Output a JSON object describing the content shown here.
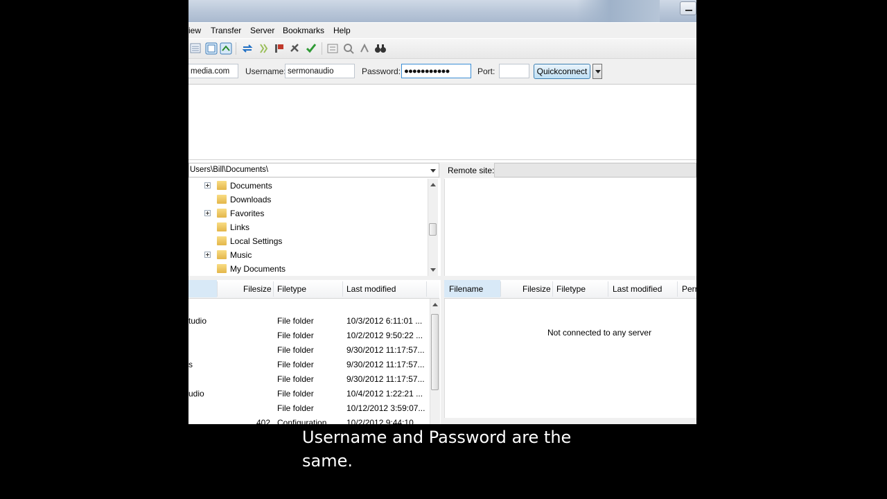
{
  "window": {
    "title": ""
  },
  "menu": [
    "iew",
    "Transfer",
    "Server",
    "Bookmarks",
    "Help"
  ],
  "quickconnect": {
    "host_value": "media.com",
    "username_label": "Username:",
    "username_value": "sermonaudio",
    "password_label": "Password:",
    "password_value": "●●●●●●●●●●●",
    "port_label": "Port:",
    "port_value": "",
    "connect_label": "Quickconnect"
  },
  "local": {
    "path": "Users\\Bill\\Documents\\",
    "tree": [
      {
        "label": "Documents",
        "expandable": true,
        "selected": true
      },
      {
        "label": "Downloads",
        "expandable": false
      },
      {
        "label": "Favorites",
        "expandable": true
      },
      {
        "label": "Links",
        "expandable": false
      },
      {
        "label": "Local Settings",
        "expandable": false
      },
      {
        "label": "Music",
        "expandable": true
      },
      {
        "label": "My Documents",
        "expandable": false
      }
    ],
    "columns": [
      "Filesize",
      "Filetype",
      "Last modified"
    ],
    "files": [
      {
        "name": "tudio",
        "size": "",
        "type": "File folder",
        "modified": "10/3/2012 6:11:01 ..."
      },
      {
        "name": "",
        "size": "",
        "type": "File folder",
        "modified": "10/2/2012 9:50:22 ..."
      },
      {
        "name": "",
        "size": "",
        "type": "File folder",
        "modified": "9/30/2012 11:17:57..."
      },
      {
        "name": "s",
        "size": "",
        "type": "File folder",
        "modified": "9/30/2012 11:17:57..."
      },
      {
        "name": "",
        "size": "",
        "type": "File folder",
        "modified": "9/30/2012 11:17:57..."
      },
      {
        "name": "udio",
        "size": "",
        "type": "File folder",
        "modified": "10/4/2012 1:22:21 ..."
      },
      {
        "name": "",
        "size": "",
        "type": "File folder",
        "modified": "10/12/2012 3:59:07..."
      },
      {
        "name": "",
        "size": "402",
        "type": "Configuration",
        "modified": "10/2/2012 9:44:10"
      }
    ]
  },
  "remote": {
    "site_label": "Remote site:",
    "site_value": "",
    "columns": [
      "Filename",
      "Filesize",
      "Filetype",
      "Last modified",
      "Perr"
    ],
    "status": "Not connected to any server"
  },
  "caption": "Username and Password are the same."
}
